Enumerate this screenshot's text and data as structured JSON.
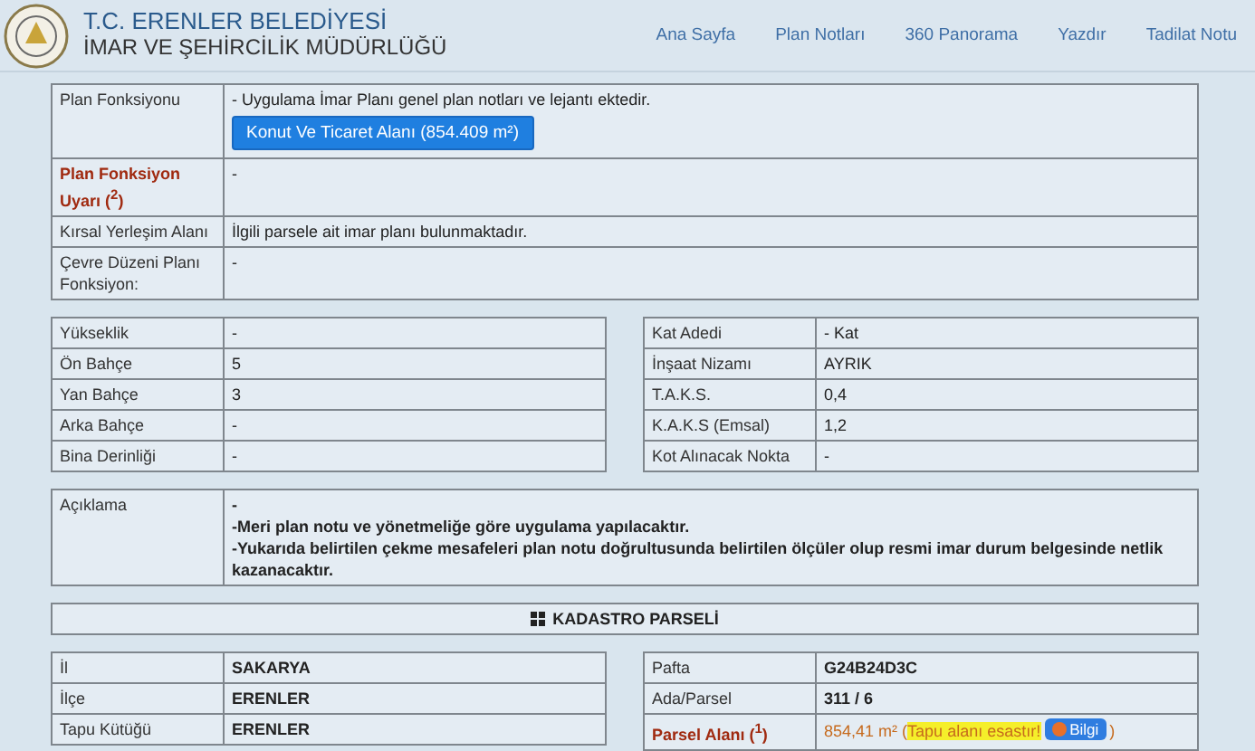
{
  "header": {
    "title": "T.C. ERENLER BELEDİYESİ",
    "subtitle": "İMAR VE ŞEHİRCİLİK MÜDÜRLÜĞÜ",
    "nav": [
      "Ana Sayfa",
      "Plan Notları",
      "360 Panorama",
      "Yazdır",
      "Tadilat Notu"
    ]
  },
  "plan_table": {
    "rows": [
      {
        "label": "Plan Fonksiyonu",
        "warning": false,
        "value": "- Uygulama İmar Planı genel plan notları ve lejantı ektedir.",
        "button": "Konut Ve Ticaret Alanı (854.409 m²)"
      },
      {
        "label": "Plan Fonksiyon Uyarı ($^{2}$)",
        "warning": true,
        "value": "-"
      },
      {
        "label": "Kırsal Yerleşim Alanı",
        "warning": false,
        "value": "İlgili parsele ait imar planı bulunmaktadır."
      },
      {
        "label": "Çevre Düzeni Planı Fonksiyon:",
        "warning": false,
        "value": "-"
      }
    ]
  },
  "building": {
    "left": [
      {
        "label": "Yükseklik",
        "value": "-"
      },
      {
        "label": "Ön Bahçe",
        "value": "5"
      },
      {
        "label": "Yan Bahçe",
        "value": "3"
      },
      {
        "label": "Arka Bahçe",
        "value": "-"
      },
      {
        "label": "Bina Derinliği",
        "value": "-"
      }
    ],
    "right": [
      {
        "label": "Kat Adedi",
        "value": "- Kat"
      },
      {
        "label": "İnşaat Nizamı",
        "value": "AYRIK"
      },
      {
        "label": "T.A.K.S.",
        "value": "0,4"
      },
      {
        "label": "K.A.K.S (Emsal)",
        "value": "1,2"
      },
      {
        "label": "Kot Alınacak Nokta",
        "value": "-"
      }
    ]
  },
  "description": {
    "label": "Açıklama",
    "lines": [
      "-",
      "-Meri plan notu ve yönetmeliğe göre uygulama yapılacaktır.",
      "-Yukarıda belirtilen çekme mesafeleri plan notu doğrultusunda belirtilen ölçüler olup resmi imar durum belgesinde netlik kazanacaktır."
    ]
  },
  "cadastre": {
    "title": "KADASTRO PARSELİ",
    "left": [
      {
        "label": "İl",
        "warning": false,
        "value": "SAKARYA"
      },
      {
        "label": "İlçe",
        "warning": false,
        "value": "ERENLER"
      },
      {
        "label": "Tapu Kütüğü",
        "warning": false,
        "value": "ERENLER"
      }
    ],
    "right": [
      {
        "label": "Pafta",
        "warning": false,
        "value": "G24B24D3C"
      },
      {
        "label": "Ada/Parsel",
        "warning": false,
        "value": "311 / 6"
      },
      {
        "label": "Parsel Alanı ($^{1}$)",
        "warning": true,
        "value": "854,41 m²",
        "note_open": "(",
        "note": "Tapu alanı esastır!",
        "info_button": "Bilgi",
        "note_close": ")"
      }
    ]
  }
}
